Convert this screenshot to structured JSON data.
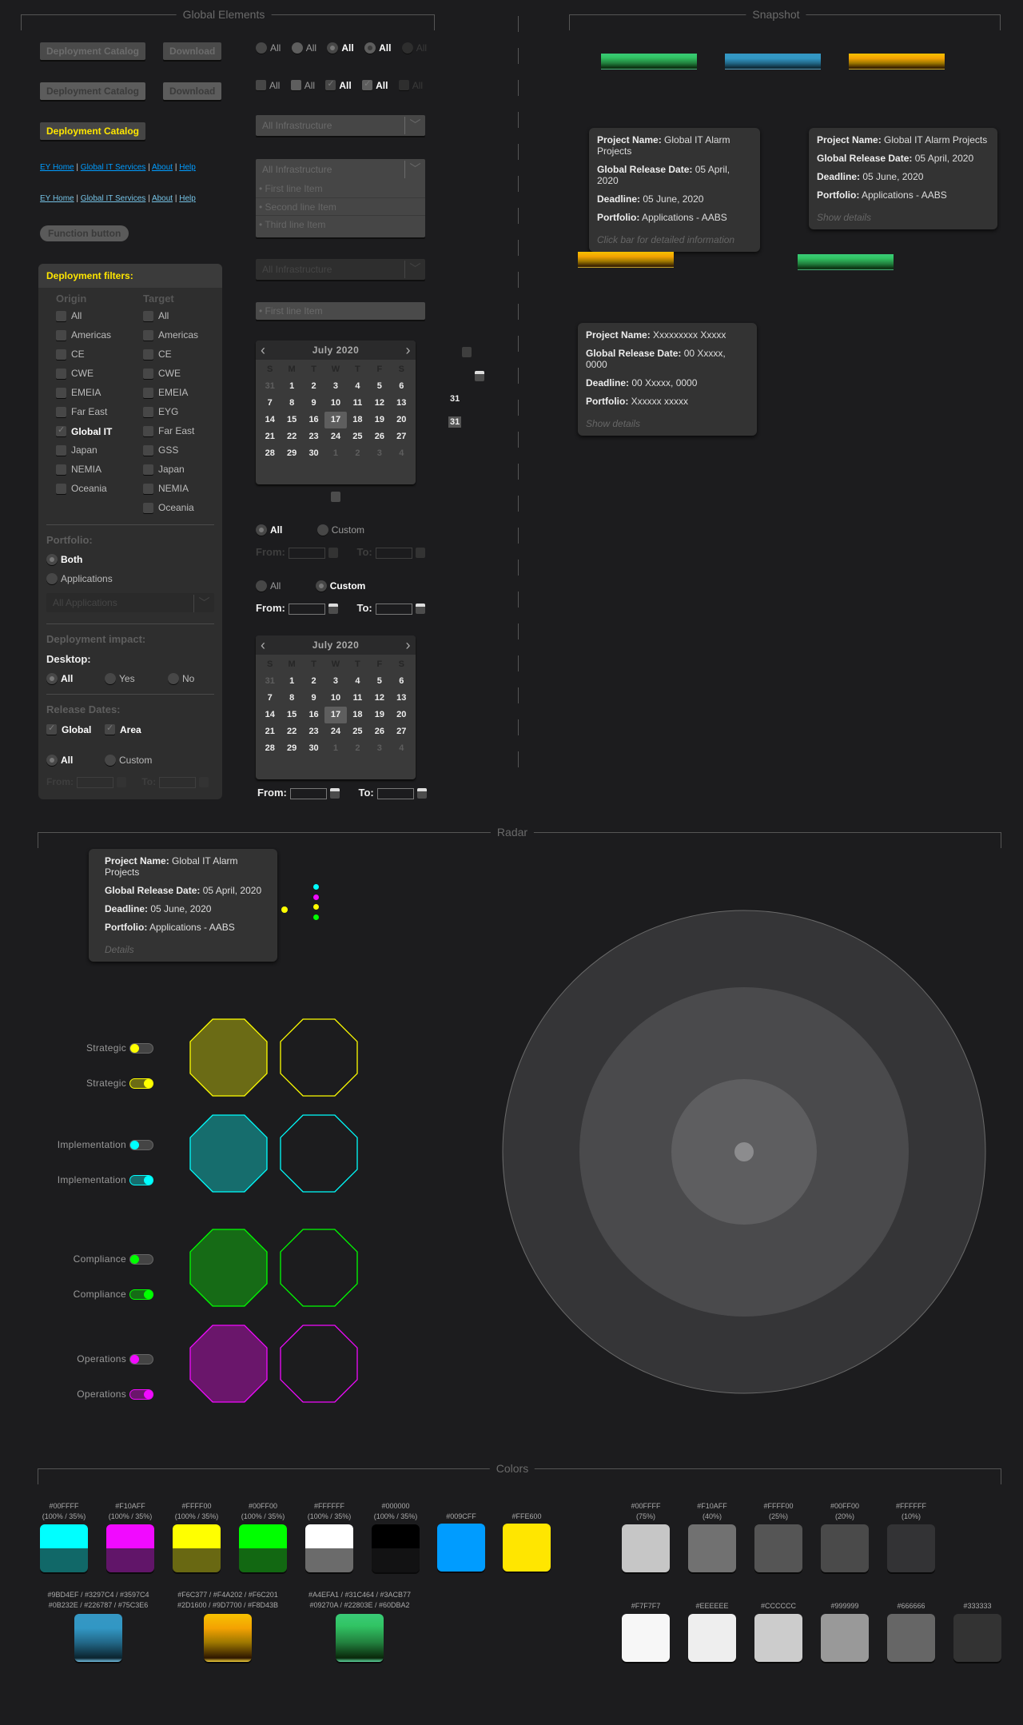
{
  "sections": {
    "global": "Global Elements",
    "snapshot": "Snapshot",
    "radar": "Radar",
    "colors": "Colors"
  },
  "buttons": {
    "deployment_catalog": "Deployment Catalog",
    "download": "Download",
    "function_button": "Function button"
  },
  "links": [
    "EY Home",
    "Global IT Services",
    "About",
    "Help"
  ],
  "link_sep": "|",
  "radio_demo": [
    "All",
    "All",
    "All",
    "All",
    "All"
  ],
  "check_demo": [
    "All",
    "All",
    "All",
    "All",
    "All"
  ],
  "dropdowns": {
    "infrastructure": "All Infrastructure",
    "items": [
      "First line Item",
      "Second line Item",
      "Third line Item"
    ],
    "arrow": "﹀"
  },
  "filters": {
    "title": "Deployment filters:",
    "origin_title": "Origin",
    "target_title": "Target",
    "origin": [
      {
        "label": "All",
        "checked": false
      },
      {
        "label": "Americas",
        "checked": false
      },
      {
        "label": "CE",
        "checked": false
      },
      {
        "label": "CWE",
        "checked": false
      },
      {
        "label": "EMEIA",
        "checked": false
      },
      {
        "label": "Far East",
        "checked": false
      },
      {
        "label": "Global IT",
        "checked": true
      },
      {
        "label": "Japan",
        "checked": false
      },
      {
        "label": "NEMIA",
        "checked": false
      },
      {
        "label": "Oceania",
        "checked": false
      }
    ],
    "target": [
      {
        "label": "All",
        "checked": false
      },
      {
        "label": "Americas",
        "checked": false
      },
      {
        "label": "CE",
        "checked": false
      },
      {
        "label": "CWE",
        "checked": false
      },
      {
        "label": "EMEIA",
        "checked": false
      },
      {
        "label": "EYG",
        "checked": false
      },
      {
        "label": "Far East",
        "checked": false
      },
      {
        "label": "GSS",
        "checked": false
      },
      {
        "label": "Japan",
        "checked": false
      },
      {
        "label": "NEMIA",
        "checked": false
      },
      {
        "label": "Oceania",
        "checked": false
      }
    ],
    "portfolio_title": "Portfolio:",
    "portfolio_options": [
      "Both",
      "Applications"
    ],
    "portfolio_selected": "Both",
    "applications_placeholder": "All Applications",
    "impact_title": "Deployment impact:",
    "desktop_title": "Desktop:",
    "desktop_options": [
      "All",
      "Yes",
      "No"
    ],
    "desktop_selected": "All",
    "release_title": "Release Dates:",
    "release_checks": [
      "Global",
      "Area"
    ],
    "range_options": [
      "All",
      "Custom"
    ],
    "range_selected": "All",
    "from_label": "From:",
    "to_label": "To:"
  },
  "calendar": {
    "title": "July 2020",
    "prev": "‹",
    "next": "›",
    "dow": [
      "S",
      "M",
      "T",
      "W",
      "T",
      "F",
      "S"
    ],
    "days": [
      "31",
      "1",
      "2",
      "3",
      "4",
      "5",
      "6",
      "7",
      "8",
      "9",
      "10",
      "11",
      "12",
      "13",
      "14",
      "15",
      "16",
      "17",
      "18",
      "19",
      "20",
      "21",
      "22",
      "23",
      "24",
      "25",
      "26",
      "27",
      "28",
      "29",
      "30",
      "1",
      "2",
      "3",
      "4"
    ],
    "today": "17",
    "day_icon": "31"
  },
  "date_range": {
    "all": "All",
    "custom": "Custom",
    "from": "From:",
    "to": "To:"
  },
  "project_card": {
    "name_label": "Project Name:",
    "name": "Global IT Alarm Projects",
    "release_label": "Global Release Date:",
    "release": "05 April, 2020",
    "deadline_label": "Deadline:",
    "deadline": "05 June, 2020",
    "portfolio_label": "Portfolio:",
    "portfolio": "Applications - AABS",
    "hint_click": "Click bar for detailed information",
    "hint_show": "Show details",
    "hint_details": "Details"
  },
  "placeholder_card": {
    "name": "Xxxxxxxxx Xxxxx",
    "release": "00 Xxxxx, 0000",
    "deadline": "00 Xxxxx, 0000",
    "portfolio": "Xxxxxx xxxxx"
  },
  "radar": {
    "categories": [
      {
        "label": "Strategic",
        "color": "#FFFF00",
        "fill": "#6b6b15"
      },
      {
        "label": "Implementation",
        "color": "#00FFFF",
        "fill": "#166d6d"
      },
      {
        "label": "Compliance",
        "color": "#00FF00",
        "fill": "#166b16"
      },
      {
        "label": "Operations",
        "color": "#F10AFF",
        "fill": "#6a166b"
      }
    ]
  },
  "colors": {
    "dual": [
      {
        "hex": "#00FFFF",
        "note": "(100% /  35%)",
        "top": "#00FFFF",
        "bot": "#116868"
      },
      {
        "hex": "#F10AFF",
        "note": "(100% /  35%)",
        "top": "#F10AFF",
        "bot": "#611569"
      },
      {
        "hex": "#FFFF00",
        "note": "(100% /  35%)",
        "top": "#FFFF00",
        "bot": "#696812"
      },
      {
        "hex": "#00FF00",
        "note": "(100% /  35%)",
        "top": "#00FF00",
        "bot": "#126812"
      },
      {
        "hex": "#FFFFFF",
        "note": "(100% /  35%)",
        "top": "#FFFFFF",
        "bot": "#6b6b6b"
      },
      {
        "hex": "#000000",
        "note": "(100% /  35%)",
        "top": "#000000",
        "bot": "#121213"
      }
    ],
    "solid": [
      {
        "hex": "#009CFF"
      },
      {
        "hex": "#FFE600"
      }
    ],
    "gradients": [
      {
        "line1": "#9BD4EF / #3297C4 / #3597C4",
        "line2": "#0B232E / #226787 / #75C3E6",
        "kind": "blue"
      },
      {
        "line1": "#F6C377 / #F4A202 / #F6C201",
        "line2": "#2D1600 / #9D7700 / #F8D43B",
        "kind": "gold"
      },
      {
        "line1": "#A4EFA1 / #31C464 / #3ACB77",
        "line2": "#09270A / #22803E / #60DBA2",
        "kind": "green"
      }
    ],
    "opacity": [
      {
        "hex": "#00FFFF",
        "note": "(75%)",
        "shade": "#c6c6c6"
      },
      {
        "hex": "#F10AFF",
        "note": "(40%)",
        "shade": "#717171"
      },
      {
        "hex": "#FFFF00",
        "note": "(25%)",
        "shade": "#555555"
      },
      {
        "hex": "#00FF00",
        "note": "(20%)",
        "shade": "#4a4a4a"
      },
      {
        "hex": "#FFFFFF",
        "note": "(10%)",
        "shade": "#333335"
      }
    ],
    "grays": [
      "#F7F7F7",
      "#EEEEEE",
      "#CCCCCC",
      "#999999",
      "#666666",
      "#333333"
    ]
  }
}
